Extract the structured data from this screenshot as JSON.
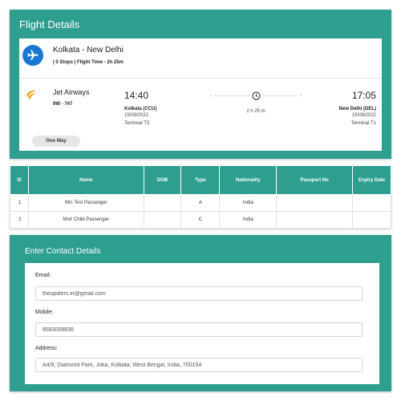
{
  "flight_details": {
    "title": "Flight Details",
    "route": "Kolkata - New Delhi",
    "meta": "| 0 Stops | Flight Time - 2h 25m",
    "airline": "Jet Airways",
    "flight_code": "9W - 747",
    "departure": {
      "time": "14:40",
      "city": "Kolkata (CCU)",
      "date": "15/09/2022",
      "terminal": "Terminal T3"
    },
    "arrival": {
      "time": "17:05",
      "city": "New Delhi (DEL)",
      "date": "15/09/2022",
      "terminal": "Terminal T1"
    },
    "duration": "2 h 25 m",
    "trip_type": "One Way"
  },
  "passengers": {
    "headers": [
      "Sl",
      "Name",
      "DOB",
      "Type",
      "Nationality",
      "Passport No",
      "Expiry Date"
    ],
    "rows": [
      {
        "sl": "1",
        "name": "Mrs Test Passenger",
        "dob": "",
        "type": "A",
        "nationality": "India",
        "passport": "",
        "expiry": ""
      },
      {
        "sl": "2",
        "name": "Mstr Child Passenger",
        "dob": "",
        "type": "C",
        "nationality": "India",
        "passport": "",
        "expiry": ""
      }
    ]
  },
  "contact": {
    "title": "Enter Contact Details",
    "email_label": "Email:",
    "email_value": "thespiders.in@gmail.com",
    "mobile_label": "Mobile:",
    "mobile_value": "8583008836",
    "address_label": "Address:",
    "address_value": "A4/9, Diamond Park, Joka, Kolkata, West Bengal, India, 700104"
  },
  "colors": {
    "accent": "#2e9e8f",
    "plane_badge": "#1976d2",
    "airline_logo": "#f5a623"
  },
  "icons": [
    "plane-icon",
    "jet-airways-logo",
    "chevron-right-icon",
    "clock-icon"
  ]
}
